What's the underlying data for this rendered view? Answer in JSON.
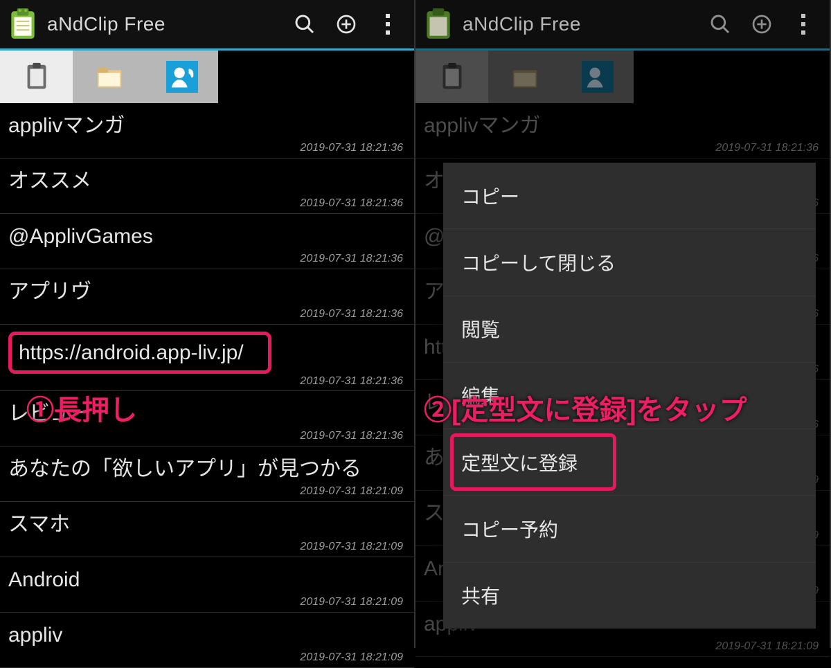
{
  "app": {
    "title": "aNdClip Free"
  },
  "tabs": [
    {
      "name": "clipboard"
    },
    {
      "name": "folder"
    },
    {
      "name": "contacts"
    }
  ],
  "clips": [
    {
      "title": "applivマンガ",
      "ts": "2019-07-31 18:21:36"
    },
    {
      "title": "オススメ",
      "ts": "2019-07-31 18:21:36"
    },
    {
      "title": "@ApplivGames",
      "ts": "2019-07-31 18:21:36"
    },
    {
      "title": "アプリヴ",
      "ts": "2019-07-31 18:21:36"
    },
    {
      "title": "https://android.app-liv.jp/",
      "ts": "2019-07-31 18:21:36",
      "highlight": true
    },
    {
      "title": "レビュー",
      "ts": "2019-07-31 18:21:36"
    },
    {
      "title": "あなたの「欲しいアプリ」が見つかる",
      "ts": "2019-07-31 18:21:09"
    },
    {
      "title": "スマホ",
      "ts": "2019-07-31 18:21:09"
    },
    {
      "title": "Android",
      "ts": "2019-07-31 18:21:09"
    },
    {
      "title": "appliv",
      "ts": "2019-07-31 18:21:09"
    }
  ],
  "menu": {
    "items": [
      {
        "label": "コピー"
      },
      {
        "label": "コピーして閉じる"
      },
      {
        "label": "閲覧"
      },
      {
        "label": "編集"
      },
      {
        "label": "定型文に登録",
        "highlight": true
      },
      {
        "label": "コピー予約"
      },
      {
        "label": "共有"
      }
    ]
  },
  "annot": {
    "left": "①長押し",
    "right": "②[定型文に登録]をタップ"
  }
}
